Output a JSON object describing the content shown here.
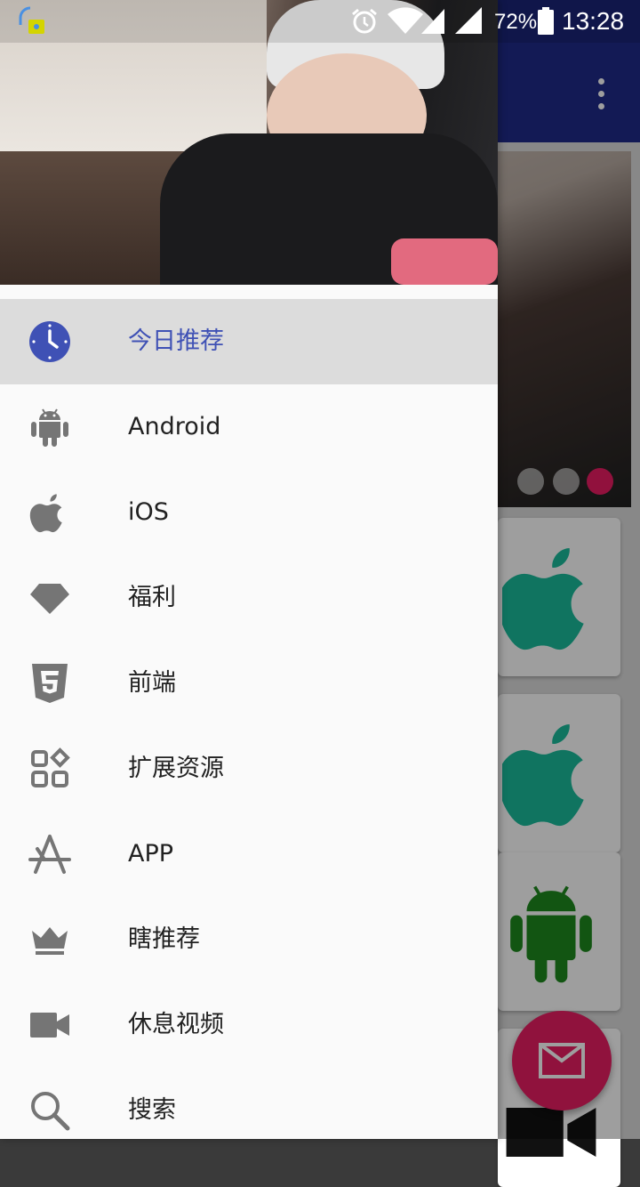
{
  "status_bar": {
    "time": "13:28",
    "battery_percent": "72%",
    "icons": [
      "app-notification-icon",
      "alarm-icon",
      "wifi-icon",
      "signal-icon",
      "signal-icon-2",
      "battery-icon"
    ]
  },
  "drawer": {
    "selected_index": 0,
    "items": [
      {
        "label": "今日推荐",
        "icon": "clock-icon"
      },
      {
        "label": "Android",
        "icon": "android-icon"
      },
      {
        "label": "iOS",
        "icon": "apple-icon"
      },
      {
        "label": "福利",
        "icon": "diamond-icon"
      },
      {
        "label": "前端",
        "icon": "html5-icon"
      },
      {
        "label": "扩展资源",
        "icon": "widgets-icon"
      },
      {
        "label": "APP",
        "icon": "app-store-icon"
      },
      {
        "label": "瞎推荐",
        "icon": "crown-icon"
      },
      {
        "label": "休息视频",
        "icon": "videocam-icon"
      },
      {
        "label": "搜索",
        "icon": "search-icon"
      }
    ]
  },
  "colors": {
    "primary": "#1f2b8a",
    "accent": "#e91e63",
    "selected_text": "#3f51b5",
    "icon_gray": "#757575",
    "teal": "#1abc9c",
    "android_green": "#1e8a1e"
  }
}
